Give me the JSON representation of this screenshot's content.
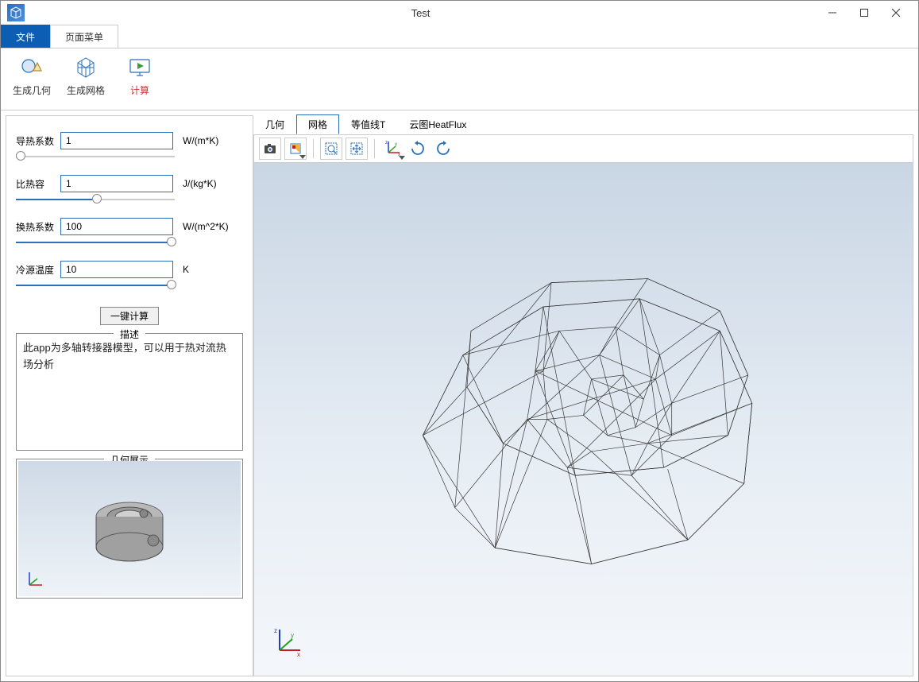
{
  "window": {
    "title": "Test"
  },
  "tabs": {
    "file": "文件",
    "page_menu": "页面菜单"
  },
  "ribbon": {
    "gen_geom": "生成几何",
    "gen_mesh": "生成网格",
    "compute": "计算"
  },
  "params": {
    "thermal_cond": {
      "label": "导热系数",
      "value": "1",
      "unit": "W/(m*K)"
    },
    "spec_heat": {
      "label": "比热容",
      "value": "1",
      "unit": "J/(kg*K)"
    },
    "heat_transfer": {
      "label": "换热系数",
      "value": "100",
      "unit": "W/(m^2*K)"
    },
    "cold_temp": {
      "label": "冷源温度",
      "value": "10",
      "unit": "K"
    }
  },
  "one_click": "一键计算",
  "desc": {
    "legend": "描述",
    "text": "此app为多轴转接器模型，可以用于热对流热场分析"
  },
  "geom_preview_legend": "几何展示",
  "view_tabs": {
    "geom": "几何",
    "mesh": "网格",
    "contour": "等值线T",
    "cloud": "云图HeatFlux"
  }
}
